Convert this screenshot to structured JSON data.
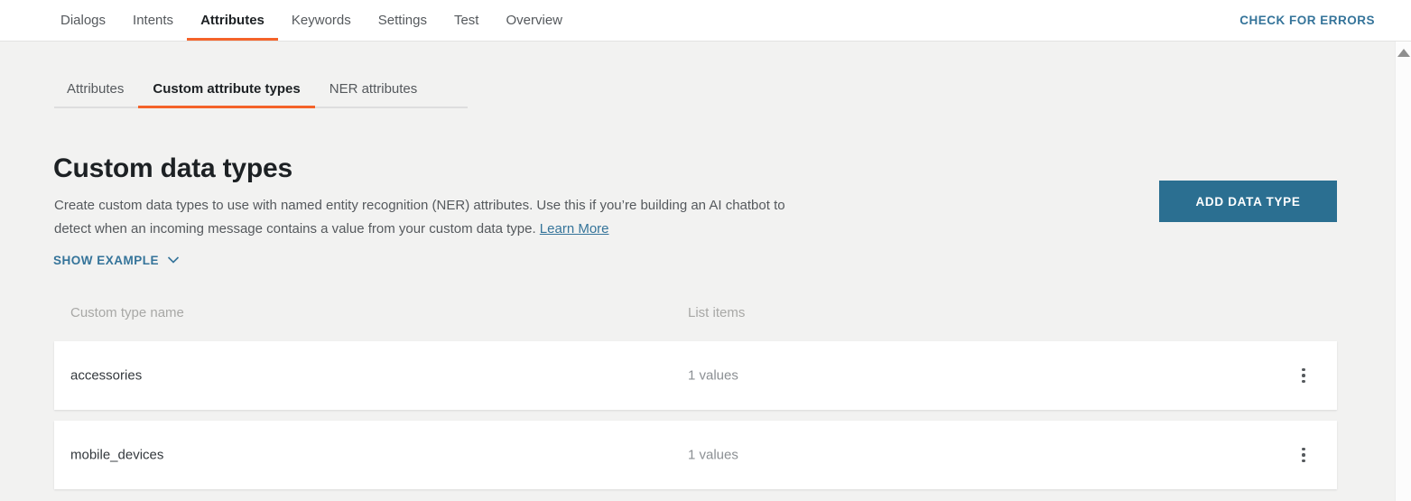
{
  "header": {
    "nav_items": [
      {
        "label": "Dialogs",
        "active": false
      },
      {
        "label": "Intents",
        "active": false
      },
      {
        "label": "Attributes",
        "active": true
      },
      {
        "label": "Keywords",
        "active": false
      },
      {
        "label": "Settings",
        "active": false
      },
      {
        "label": "Test",
        "active": false
      },
      {
        "label": "Overview",
        "active": false
      }
    ],
    "check_errors_label": "CHECK FOR ERRORS"
  },
  "subtabs": [
    {
      "label": "Attributes",
      "active": false
    },
    {
      "label": "Custom attribute types",
      "active": true
    },
    {
      "label": "NER attributes",
      "active": false
    }
  ],
  "main": {
    "title": "Custom data types",
    "description_part1": "Create custom data types to use with named entity recognition (NER) attributes. Use this if you’re building an AI chatbot to detect when an incoming message contains a value from your custom data type. ",
    "learn_more_label": "Learn More",
    "add_button_label": "ADD DATA TYPE",
    "show_example_label": "SHOW EXAMPLE"
  },
  "table": {
    "columns": [
      "Custom type name",
      "List items"
    ],
    "rows": [
      {
        "name": "accessories",
        "items": "1 values"
      },
      {
        "name": "mobile_devices",
        "items": "1 values"
      }
    ]
  },
  "colors": {
    "accent_orange": "#f4632a",
    "link_blue": "#35749a",
    "button_blue": "#2b6f91",
    "page_background": "#f2f2f1",
    "row_background": "#ffffff"
  }
}
